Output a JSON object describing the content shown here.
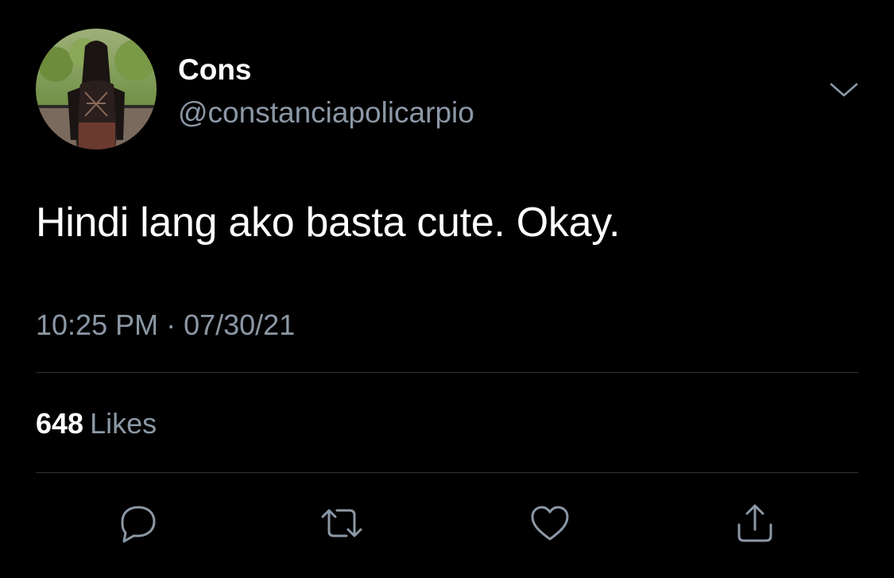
{
  "tweet": {
    "display_name": "Cons",
    "handle": "@constanciapolicarpio",
    "text": "Hindi lang ako basta cute. Okay.",
    "timestamp": "10:25 PM · 07/30/21",
    "likes_count": "648",
    "likes_label": "Likes"
  },
  "icons": {
    "avatar": "profile-photo",
    "more": "chevron-down-icon",
    "reply": "reply-icon",
    "retweet": "retweet-icon",
    "like": "heart-icon",
    "share": "share-icon"
  },
  "colors": {
    "background": "#000000",
    "primary_text": "#ffffff",
    "secondary_text": "#8b98a5",
    "divider": "#2f3336"
  }
}
